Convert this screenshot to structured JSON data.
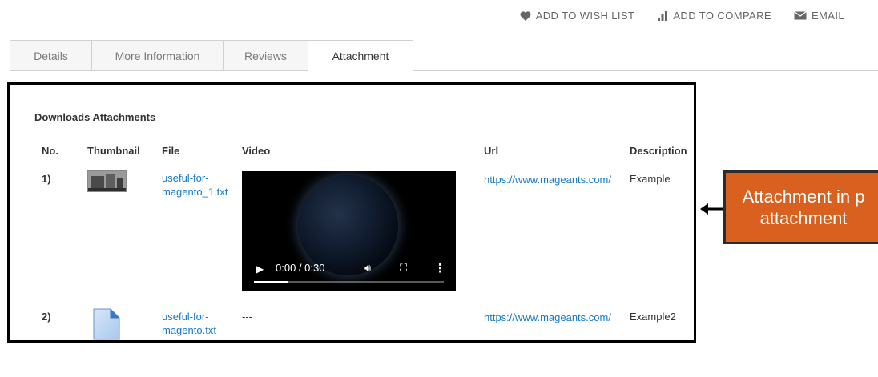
{
  "top_actions": {
    "wishlist": "ADD TO WISH LIST",
    "compare": "ADD TO COMPARE",
    "email": "EMAIL"
  },
  "tabs": [
    {
      "label": "Details",
      "active": false
    },
    {
      "label": "More Information",
      "active": false
    },
    {
      "label": "Reviews",
      "active": false
    },
    {
      "label": "Attachment",
      "active": true
    }
  ],
  "attachments": {
    "title": "Downloads Attachments",
    "columns": [
      "No.",
      "Thumbnail",
      "File",
      "Video",
      "Url",
      "Description"
    ],
    "rows": [
      {
        "no": "1)",
        "thumbnail_icon": "building-photo-thumbnail",
        "file_line1": "useful-for-",
        "file_line2": "magento_1.txt",
        "video": {
          "current_time": "0:00 / 0:30",
          "progress": 0.0
        },
        "url": "https://www.mageants.com/",
        "description": "Example"
      },
      {
        "no": "2)",
        "thumbnail_icon": "document-file-icon",
        "file_line1": "useful-for-",
        "file_line2": "magento.txt",
        "video_placeholder": "---",
        "url": "https://www.mageants.com/",
        "description": "Example2"
      }
    ]
  },
  "callout": {
    "line1": "Attachment in p",
    "line2": "attachment"
  },
  "colors": {
    "link": "#1979c3",
    "callout_bg": "#d9601f",
    "panel_border": "#000000"
  }
}
